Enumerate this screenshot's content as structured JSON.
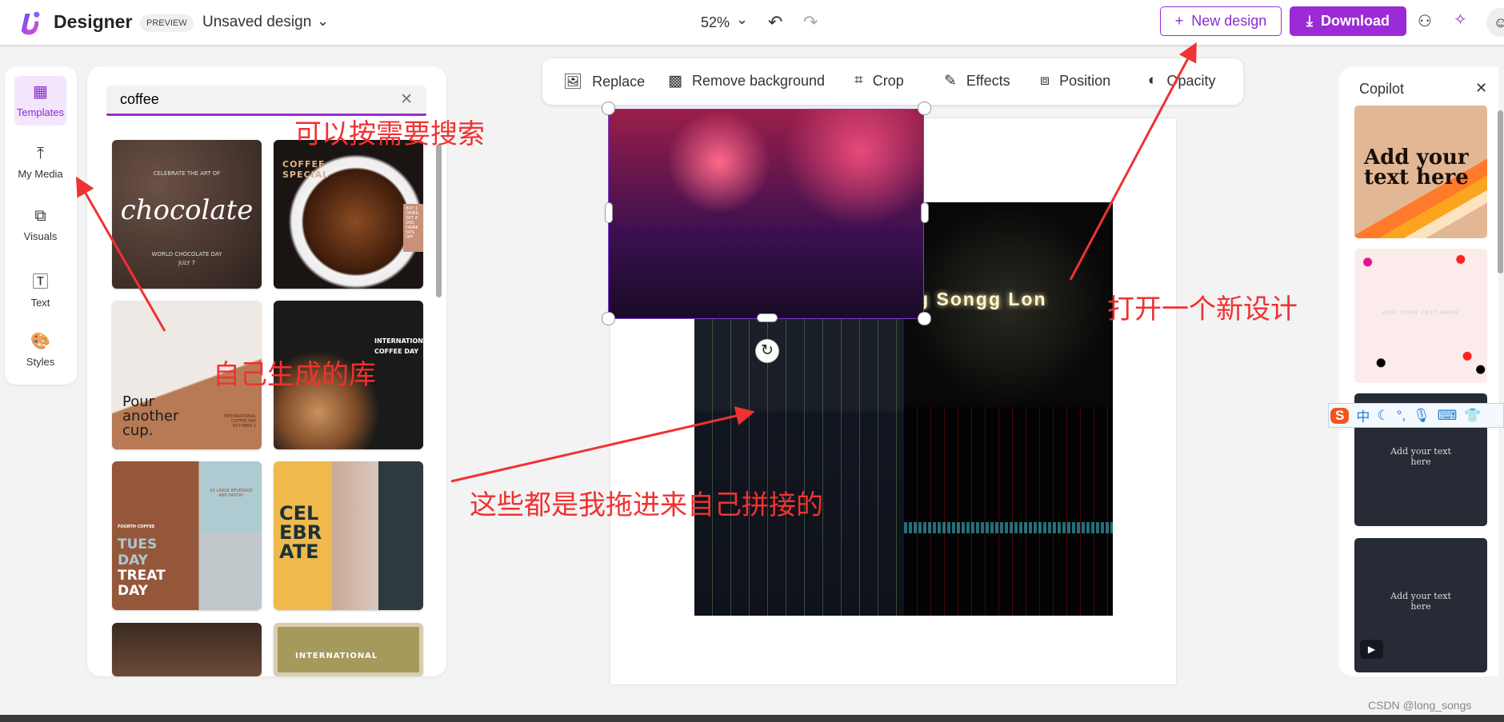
{
  "header": {
    "brand": "Designer",
    "badge": "PREVIEW",
    "design_title": "Unsaved design",
    "zoom": "52%",
    "new_design": "New design",
    "download": "Download"
  },
  "rail": [
    {
      "label": "Templates",
      "icon": "grid-icon",
      "active": true
    },
    {
      "label": "My Media",
      "icon": "upload-icon"
    },
    {
      "label": "Visuals",
      "icon": "shapes-icon"
    },
    {
      "label": "Text",
      "icon": "text-icon"
    },
    {
      "label": "Styles",
      "icon": "palette-icon"
    }
  ],
  "search": {
    "value": "coffee"
  },
  "templates": [
    {
      "lines": [
        "CELEBRATE THE ART OF",
        "chocolate",
        "WORLD CHOCOLATE DAY",
        "JULY 7"
      ]
    },
    {
      "lines": [
        "COFFEE",
        "SPECIAL",
        "BUY 1 DRINK, GET A 2ND DRINK 50% OFF"
      ]
    },
    {
      "lines": [
        "Pour",
        "another",
        "cup.",
        "INTERNATIONAL COFFEE DAY OCTOBER 1"
      ]
    },
    {
      "lines": [
        "INTERNATIONAL",
        "COFFEE DAY"
      ]
    },
    {
      "lines": [
        "FOURTH COFFEE",
        "TUES",
        "DAY",
        "TREAT",
        "DAY",
        "$5 LARGE BEVERAGE AND PASTRY"
      ]
    },
    {
      "lines": [
        "CEL",
        "EBR",
        "ATE"
      ]
    },
    {
      "lines": []
    },
    {
      "lines": [
        "INTERNATIONAL"
      ]
    }
  ],
  "toolbar": [
    "Replace",
    "Remove background",
    "Crop",
    "Effects",
    "Position",
    "Opacity"
  ],
  "canvas": {
    "image_text": "ng  Songg Lon"
  },
  "copilot": {
    "title": "Copilot",
    "items": [
      "Add your text here",
      "ADD YOUR TEXT HERE",
      "Add your text here",
      "Add your text here"
    ]
  },
  "annotations": [
    "可以按需要搜索",
    "自己生成的库",
    "这些都是我拖进来自己拼接的",
    "打开一个新设计"
  ],
  "ime": {
    "label": "中"
  },
  "watermark": "CSDN @long_songs",
  "colors": {
    "accent": "#9b2bd6",
    "annotation": "#f03232"
  }
}
